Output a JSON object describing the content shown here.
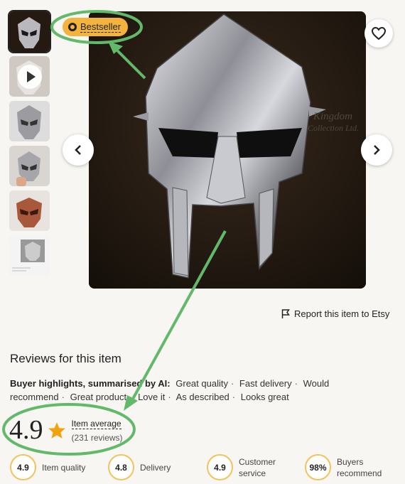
{
  "thumbnails": [
    {
      "name": "thumb-mask-front",
      "active": true
    },
    {
      "name": "thumb-video",
      "video": true
    },
    {
      "name": "thumb-mask-silver"
    },
    {
      "name": "thumb-mask-hand"
    },
    {
      "name": "thumb-mask-copper"
    },
    {
      "name": "thumb-mask-diagram"
    }
  ],
  "badge": {
    "label": "Bestseller"
  },
  "image_watermark": {
    "line1": "Kingdom",
    "line2": "Collection Ltd."
  },
  "report": {
    "label": "Report this item to Etsy"
  },
  "reviews": {
    "title": "Reviews for this item",
    "highlights_lead": "Buyer highlights, summarised by AI:",
    "highlights": [
      "Great quality",
      "Fast delivery",
      "Would recommend",
      "Great product",
      "Love it",
      "As described",
      "Looks great"
    ],
    "rating": "4.9",
    "item_average": "Item average",
    "review_count": "(231 reviews)"
  },
  "metrics": [
    {
      "value": "4.9",
      "label": "Item quality"
    },
    {
      "value": "4.8",
      "label": "Delivery"
    },
    {
      "value": "4.9",
      "label": "Customer service"
    },
    {
      "value": "98%",
      "label": "Buyers recommend"
    }
  ],
  "colors": {
    "badge": "#f3b33d",
    "star": "#f1a20f",
    "annotation": "#63b96a",
    "metric_ring": "#f1c35a"
  },
  "icons": [
    "award-icon",
    "heart-icon",
    "chevron-left-icon",
    "chevron-right-icon",
    "play-icon",
    "flag-icon",
    "star-icon"
  ]
}
